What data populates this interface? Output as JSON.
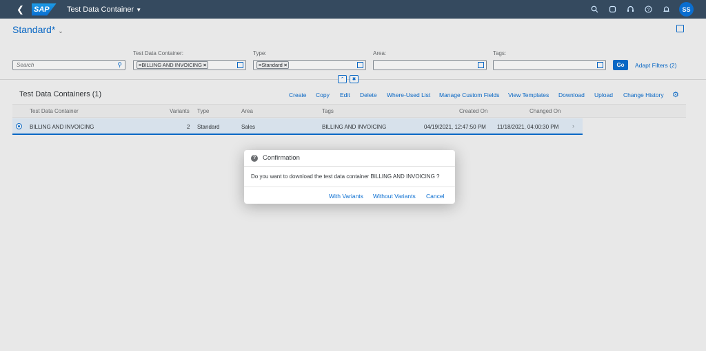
{
  "shell": {
    "logo": "SAP",
    "app_title": "Test Data Container",
    "avatar_initials": "SS"
  },
  "variant": {
    "name": "Standard*"
  },
  "filters": {
    "search_placeholder": "Search",
    "test_data_container_label": "Test Data Container:",
    "test_data_container_token": "=BILLING AND INVOICING",
    "type_label": "Type:",
    "type_token": "=Standard",
    "area_label": "Area:",
    "tags_label": "Tags:",
    "go_label": "Go",
    "adapt_filters_label": "Adapt Filters (2)"
  },
  "table": {
    "title": "Test Data Containers (1)",
    "toolbar": [
      "Create",
      "Copy",
      "Edit",
      "Delete",
      "Where-Used List",
      "Manage Custom Fields",
      "View Templates",
      "Download",
      "Upload",
      "Change History"
    ],
    "columns": [
      "Test Data Container",
      "Variants",
      "Type",
      "Area",
      "Tags",
      "Created On",
      "Changed On"
    ],
    "rows": [
      {
        "name": "BILLING AND INVOICING",
        "variants": "2",
        "type": "Standard",
        "area": "Sales",
        "tags": "BILLING AND INVOICING",
        "created_on": "04/19/2021, 12:47:50 PM",
        "changed_on": "11/18/2021, 04:00:30 PM"
      }
    ]
  },
  "dialog": {
    "title": "Confirmation",
    "message": "Do you want to download the test data container BILLING AND INVOICING ?",
    "buttons": [
      "With Variants",
      "Without Variants",
      "Cancel"
    ]
  },
  "colors": {
    "shell_bg": "#354a5f",
    "accent": "#0a6ed1",
    "selected_row": "#e5f0fa"
  }
}
